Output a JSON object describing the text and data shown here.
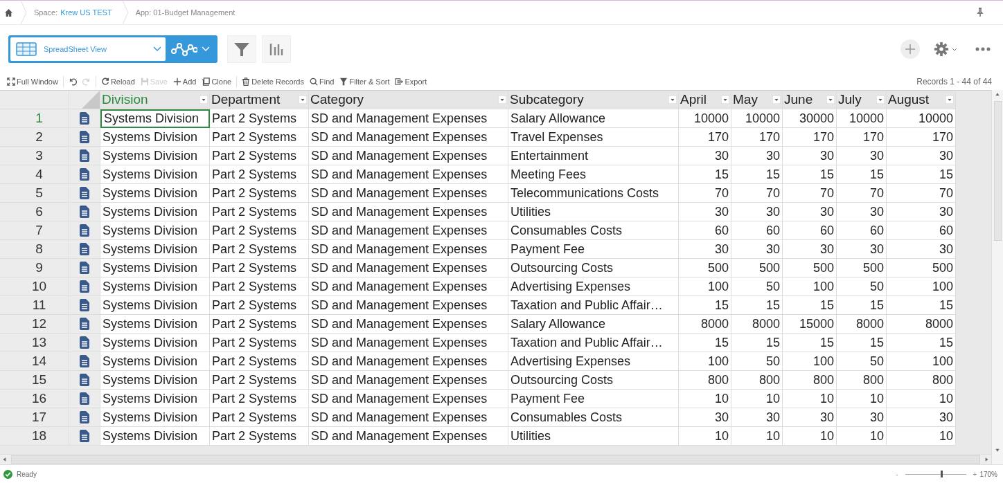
{
  "breadcrumb": {
    "space_prefix": "Space:",
    "space": "Krew US TEST",
    "app": "App: 01-Budget Management"
  },
  "view_selector": {
    "label": "SpreadSheet View"
  },
  "toolbar_groups": [
    [
      {
        "kind": "full-window",
        "label": "Full Window",
        "disabled": false
      }
    ],
    [
      {
        "kind": "undo",
        "disabled": false
      },
      {
        "kind": "redo",
        "disabled": true
      }
    ],
    [
      {
        "kind": "reload",
        "label": "Reload",
        "disabled": false
      },
      {
        "kind": "save",
        "label": "Save",
        "disabled": true
      },
      {
        "kind": "add",
        "label": "Add",
        "disabled": false
      },
      {
        "kind": "clone",
        "label": "Clone",
        "disabled": false
      }
    ],
    [
      {
        "kind": "delete",
        "label": "Delete Records",
        "disabled": false
      },
      {
        "kind": "find",
        "label": "Find",
        "disabled": false
      },
      {
        "kind": "filter",
        "label": "Filter & Sort",
        "disabled": false
      },
      {
        "kind": "export",
        "label": "Export",
        "disabled": false
      }
    ]
  ],
  "records_count": "Records 1 - 44 of 44",
  "columns": [
    {
      "label": "Division",
      "kind": "text",
      "selected": true
    },
    {
      "label": "Department",
      "kind": "text",
      "selected": false
    },
    {
      "label": "Category",
      "kind": "text",
      "selected": false
    },
    {
      "label": "Subcategory",
      "kind": "text",
      "selected": false
    },
    {
      "label": "April",
      "kind": "number",
      "selected": false
    },
    {
      "label": "May",
      "kind": "number",
      "selected": false
    },
    {
      "label": "June",
      "kind": "number",
      "selected": false
    },
    {
      "label": "July",
      "kind": "number",
      "selected": false
    },
    {
      "label": "August",
      "kind": "number",
      "selected": false
    }
  ],
  "rows": [
    {
      "number": "1",
      "selected": true,
      "cells": [
        "Systems Division",
        "Part 2 Systems",
        "SD and Management Expenses",
        "Salary Allowance",
        "10000",
        "10000",
        "30000",
        "10000",
        "10000"
      ]
    },
    {
      "number": "2",
      "selected": false,
      "cells": [
        "Systems Division",
        "Part 2 Systems",
        "SD and Management Expenses",
        "Travel Expenses",
        "170",
        "170",
        "170",
        "170",
        "170"
      ]
    },
    {
      "number": "3",
      "selected": false,
      "cells": [
        "Systems Division",
        "Part 2 Systems",
        "SD and Management Expenses",
        "Entertainment",
        "30",
        "30",
        "30",
        "30",
        "30"
      ]
    },
    {
      "number": "4",
      "selected": false,
      "cells": [
        "Systems Division",
        "Part 2 Systems",
        "SD and Management Expenses",
        "Meeting Fees",
        "15",
        "15",
        "15",
        "15",
        "15"
      ]
    },
    {
      "number": "5",
      "selected": false,
      "cells": [
        "Systems Division",
        "Part 2 Systems",
        "SD and Management Expenses",
        "Telecommunications Costs",
        "70",
        "70",
        "70",
        "70",
        "70"
      ]
    },
    {
      "number": "6",
      "selected": false,
      "cells": [
        "Systems Division",
        "Part 2 Systems",
        "SD and Management Expenses",
        "Utilities",
        "30",
        "30",
        "30",
        "30",
        "30"
      ]
    },
    {
      "number": "7",
      "selected": false,
      "cells": [
        "Systems Division",
        "Part 2 Systems",
        "SD and Management Expenses",
        "Consumables Costs",
        "60",
        "60",
        "60",
        "60",
        "60"
      ]
    },
    {
      "number": "8",
      "selected": false,
      "cells": [
        "Systems Division",
        "Part 2 Systems",
        "SD and Management Expenses",
        "Payment Fee",
        "30",
        "30",
        "30",
        "30",
        "30"
      ]
    },
    {
      "number": "9",
      "selected": false,
      "cells": [
        "Systems Division",
        "Part 2 Systems",
        "SD and Management Expenses",
        "Outsourcing Costs",
        "500",
        "500",
        "500",
        "500",
        "500"
      ]
    },
    {
      "number": "10",
      "selected": false,
      "cells": [
        "Systems Division",
        "Part 2 Systems",
        "SD and Management Expenses",
        "Advertising Expenses",
        "100",
        "50",
        "100",
        "50",
        "100"
      ]
    },
    {
      "number": "11",
      "selected": false,
      "cells": [
        "Systems Division",
        "Part 2 Systems",
        "SD and Management Expenses",
        "Taxation and Public Affair…",
        "15",
        "15",
        "15",
        "15",
        "15"
      ]
    },
    {
      "number": "12",
      "selected": false,
      "cells": [
        "Systems Division",
        "Part 2 Systems",
        "SD and Management Expenses",
        "Salary Allowance",
        "8000",
        "8000",
        "15000",
        "8000",
        "8000"
      ]
    },
    {
      "number": "13",
      "selected": false,
      "cells": [
        "Systems Division",
        "Part 2 Systems",
        "SD and Management Expenses",
        "Taxation and Public Affair…",
        "15",
        "15",
        "15",
        "15",
        "15"
      ]
    },
    {
      "number": "14",
      "selected": false,
      "cells": [
        "Systems Division",
        "Part 2 Systems",
        "SD and Management Expenses",
        "Advertising Expenses",
        "100",
        "50",
        "100",
        "50",
        "100"
      ]
    },
    {
      "number": "15",
      "selected": false,
      "cells": [
        "Systems Division",
        "Part 2 Systems",
        "SD and Management Expenses",
        "Outsourcing Costs",
        "800",
        "800",
        "800",
        "800",
        "800"
      ]
    },
    {
      "number": "16",
      "selected": false,
      "cells": [
        "Systems Division",
        "Part 2 Systems",
        "SD and Management Expenses",
        "Payment Fee",
        "10",
        "10",
        "10",
        "10",
        "10"
      ]
    },
    {
      "number": "17",
      "selected": false,
      "cells": [
        "Systems Division",
        "Part 2 Systems",
        "SD and Management Expenses",
        "Consumables Costs",
        "30",
        "30",
        "30",
        "30",
        "30"
      ]
    },
    {
      "number": "18",
      "selected": false,
      "cells": [
        "Systems Division",
        "Part 2 Systems",
        "SD and Management Expenses",
        "Utilities",
        "10",
        "10",
        "10",
        "10",
        "10"
      ]
    }
  ],
  "status": {
    "label": "Ready",
    "zoom": {
      "level": 0.6,
      "reading": "170%",
      "minus": "-",
      "plus": "+"
    }
  }
}
